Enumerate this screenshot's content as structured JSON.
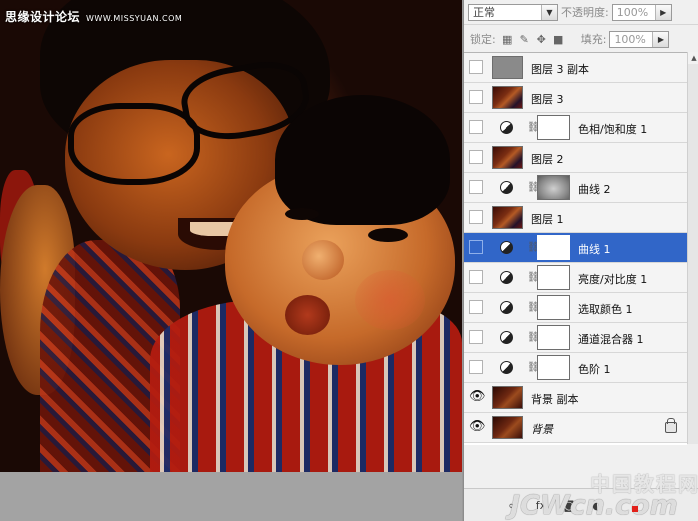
{
  "canvas": {
    "watermark_text": "思缘设计论坛",
    "watermark_url": "WWW.MISSYUAN.COM"
  },
  "layers_panel": {
    "blend_mode": "正常",
    "opacity_label": "不透明度:",
    "opacity_value": "100%",
    "lock_label": "锁定:",
    "fill_label": "填充:",
    "fill_value": "100%",
    "layers": [
      {
        "name": "图层 3 副本",
        "type": "gray",
        "visible": false,
        "selected": false
      },
      {
        "name": "图层 3",
        "type": "photo",
        "visible": false,
        "selected": false
      },
      {
        "name": "色相/饱和度 1",
        "type": "adjustment",
        "visible": false,
        "selected": false
      },
      {
        "name": "图层 2",
        "type": "photo",
        "visible": false,
        "selected": false
      },
      {
        "name": "曲线 2",
        "type": "adjustment-dark",
        "visible": false,
        "selected": false
      },
      {
        "name": "图层 1",
        "type": "photo",
        "visible": false,
        "selected": false
      },
      {
        "name": "曲线 1",
        "type": "adjustment",
        "visible": false,
        "selected": true
      },
      {
        "name": "亮度/对比度 1",
        "type": "adjustment",
        "visible": false,
        "selected": false
      },
      {
        "name": "选取颜色 1",
        "type": "adjustment",
        "visible": false,
        "selected": false
      },
      {
        "name": "通道混合器 1",
        "type": "adjustment",
        "visible": false,
        "selected": false
      },
      {
        "name": "色阶 1",
        "type": "adjustment",
        "visible": false,
        "selected": false
      },
      {
        "name": "背景 副本",
        "type": "photo2",
        "visible": true,
        "selected": false
      },
      {
        "name": "背景",
        "type": "photo2",
        "visible": true,
        "selected": false,
        "locked": true,
        "italic": true
      }
    ]
  },
  "watermark": {
    "cn": "中国教程网",
    "en": "JCWcn.com"
  },
  "colors": {
    "selection": "#3166c8",
    "panel_bg": "#f0f0f0"
  }
}
